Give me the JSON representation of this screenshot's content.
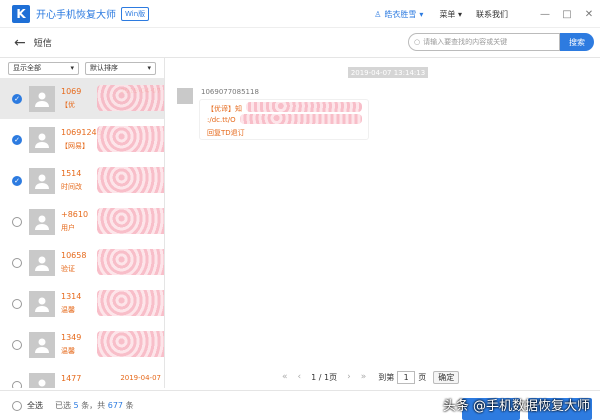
{
  "app": {
    "title": "开心手机恢复大师",
    "badge": "Win版",
    "user": "皓衣胜雪",
    "menu": "菜单",
    "contact": "联系我们",
    "min": "—",
    "max": "□",
    "close": "✕"
  },
  "page": {
    "title": "短信",
    "search_placeholder": "请输入要查找的内容或关键",
    "search_button": "搜索"
  },
  "filters": {
    "show": "显示全部",
    "sort": "默认排序"
  },
  "list": [
    {
      "num": "1069",
      "preview": "【优",
      "date": "2019-04-07",
      "checked": true
    },
    {
      "num": "10691243",
      "preview": "【网易】",
      "date": "",
      "checked": true
    },
    {
      "num": "1514",
      "preview": "时间改",
      "date": "",
      "checked": true
    },
    {
      "num": "+8610",
      "preview": "用户",
      "date": "",
      "checked": false
    },
    {
      "num": "10658",
      "preview": "验证",
      "date": "",
      "checked": false
    },
    {
      "num": "1314",
      "preview": "温馨",
      "date": "",
      "checked": false
    },
    {
      "num": "1349",
      "preview": "温馨",
      "date": "",
      "checked": false
    },
    {
      "num": "1477",
      "preview": "",
      "date": "2019-04-07",
      "checked": false
    }
  ],
  "chat": {
    "timestamp": "2019-04-07 13:14:13",
    "sender": "1069077085118",
    "line1": "【优谛】知",
    "line2": ":/dc.tt/O",
    "line3": "回复TD退订"
  },
  "pager": {
    "page": "1 / 1页",
    "goto": "到第",
    "value": "1",
    "unit": "页",
    "confirm": "确定"
  },
  "bottom": {
    "select_all": "全选",
    "selected": "已选",
    "count": "5",
    "mid": "条，共",
    "total": "677",
    "end": "条"
  },
  "watermark": "头条 @手机数据恢复大师"
}
